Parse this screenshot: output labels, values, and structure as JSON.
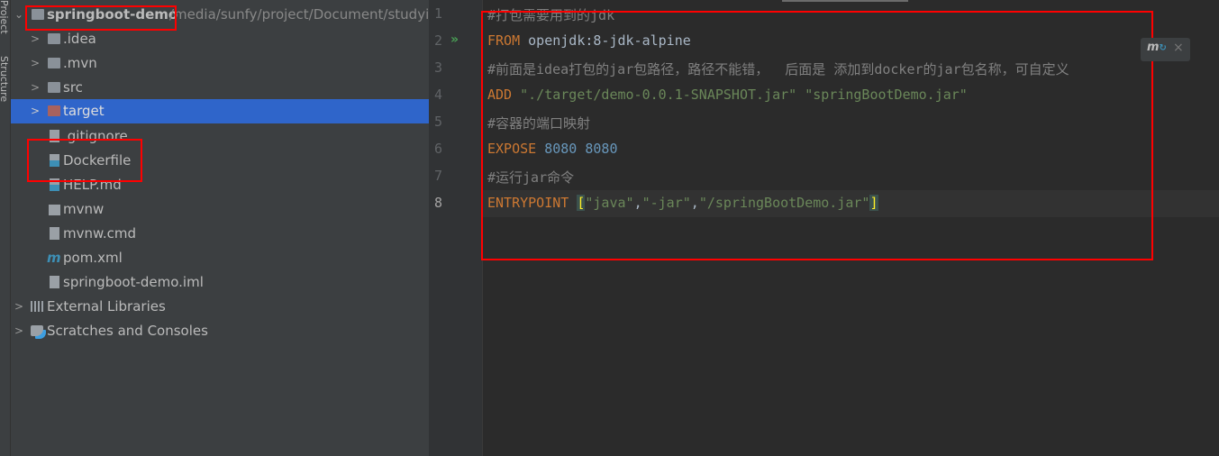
{
  "side_strip": {
    "project_label": "Project",
    "structure_label": "Structure"
  },
  "tree": {
    "root": {
      "name": "springboot-demo",
      "path": "/media/sunfy/project/Document/studying"
    },
    "items": [
      {
        "label": ".idea",
        "type": "folder"
      },
      {
        "label": ".mvn",
        "type": "folder"
      },
      {
        "label": "src",
        "type": "folder"
      },
      {
        "label": "target",
        "type": "folder-excluded",
        "selected": true
      },
      {
        "label": ".gitignore",
        "type": "file"
      },
      {
        "label": "Dockerfile",
        "type": "docker-file"
      },
      {
        "label": "HELP.md",
        "type": "markdown-file"
      },
      {
        "label": "mvnw",
        "type": "shell-file"
      },
      {
        "label": "mvnw.cmd",
        "type": "text-file"
      },
      {
        "label": "pom.xml",
        "type": "maven-file"
      },
      {
        "label": "springboot-demo.iml",
        "type": "iml-file"
      }
    ],
    "external_libraries": "External Libraries",
    "scratches": "Scratches and Consoles"
  },
  "editor": {
    "line_numbers": [
      "1",
      "2",
      "3",
      "4",
      "5",
      "6",
      "7",
      "8"
    ],
    "lines": {
      "l1": "#打包需要用到的jdk",
      "l2_kw": "FROM",
      "l2_rest": " openjdk:8-jdk-alpine",
      "l3": "#前面是idea打包的jar包路径，路径不能错，  后面是 添加到docker的jar包名称，可自定义",
      "l4_kw": "ADD",
      "l4_a": "\"./target/demo-0.0.1-SNAPSHOT.jar\"",
      "l4_b": "\"springBootDemo.jar\"",
      "l5": "#容器的端口映射",
      "l6_kw": "EXPOSE",
      "l6_a": "8080",
      "l6_b": "8080",
      "l7": "#运行jar命令",
      "l8_kw": "ENTRYPOINT",
      "l8_open": "[",
      "l8_a": "\"java\"",
      "l8_b": "\"-jar\"",
      "l8_c": "\"/springBootDemo.jar\"",
      "l8_close": "]",
      "comma": ","
    },
    "notification_close": "×"
  },
  "colors": {
    "highlight": "#ff0000",
    "selection": "#2f65ca"
  }
}
